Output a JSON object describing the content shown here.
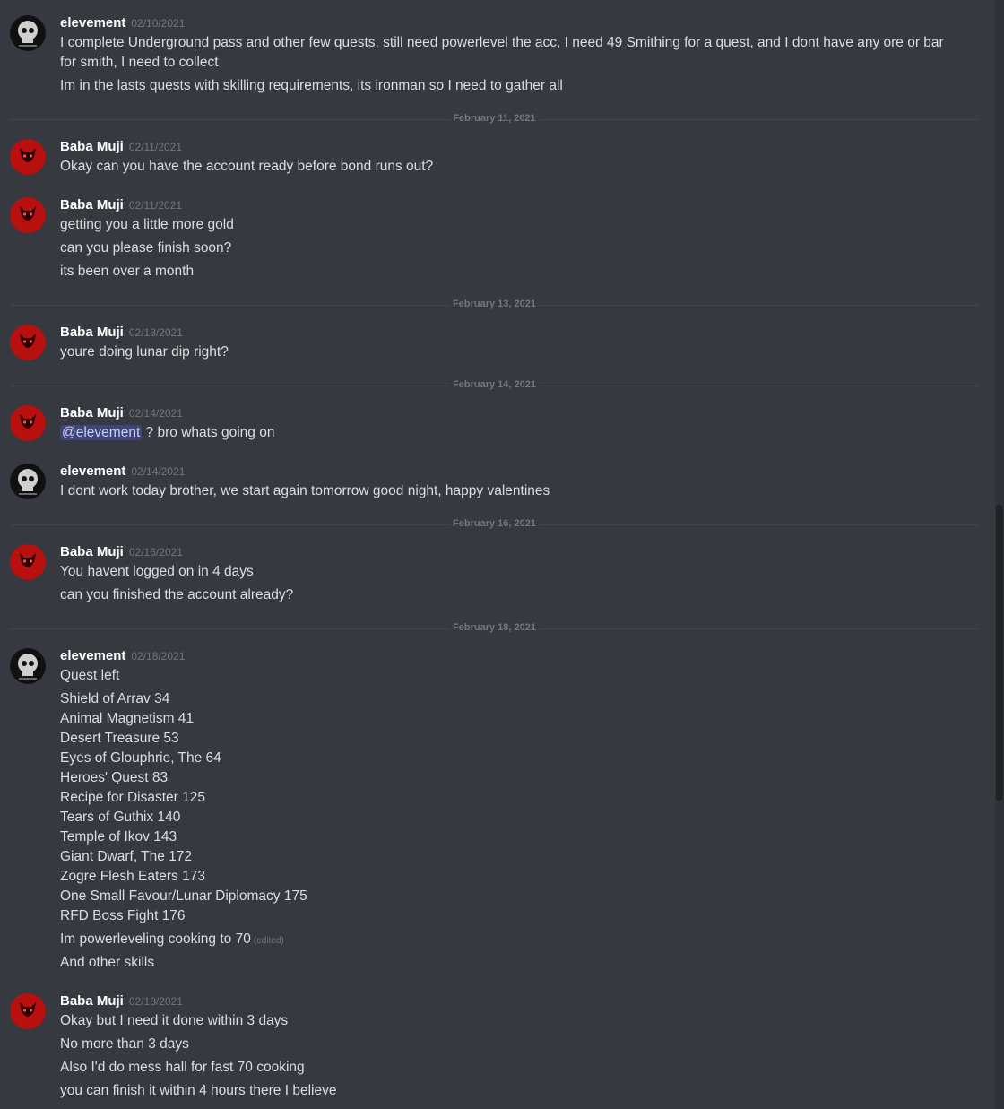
{
  "dividers": [
    {
      "text": "February 11, 2021"
    },
    {
      "text": "February 13, 2021"
    },
    {
      "text": "February 14, 2021"
    },
    {
      "text": "February 16, 2021"
    },
    {
      "text": "February 18, 2021"
    }
  ],
  "messages": [
    {
      "author": "elevement",
      "time": "02/10/2021",
      "lines": [
        "I complete Underground pass and other few quests, still need powerlevel the acc, I need 49 Smithing for a quest, and I dont have any ore or bar for smith, I need to collect",
        "Im in the lasts quests with skilling requirements, its ironman so I need to gather all"
      ]
    },
    {
      "author": "Baba Muji",
      "time": "02/11/2021",
      "lines": [
        "Okay can you have the account ready before bond runs out?"
      ]
    },
    {
      "author": "Baba Muji",
      "time": "02/11/2021",
      "lines": [
        "getting you a little more gold",
        "can you please finish soon?",
        "its been over a month"
      ]
    },
    {
      "author": "Baba Muji",
      "time": "02/13/2021",
      "lines": [
        "youre doing lunar dip right?"
      ]
    },
    {
      "author": "Baba Muji",
      "time": "02/14/2021",
      "mention": "@elevement",
      "lines": [
        " ? bro whats going on"
      ]
    },
    {
      "author": "elevement",
      "time": "02/14/2021",
      "lines": [
        "I dont work today brother, we start again tomorrow good night, happy valentines"
      ]
    },
    {
      "author": "Baba Muji",
      "time": "02/16/2021",
      "lines": [
        "You havent logged on in 4 days",
        "can you finished the account already?"
      ]
    },
    {
      "author": "elevement",
      "time": "02/18/2021",
      "edited": "(edited)",
      "lines": [
        "Quest left",
        "Shield of Arrav 34",
        "Animal Magnetism 41",
        "Desert Treasure 53",
        "Eyes of Glouphrie, The 64",
        "Heroes' Quest 83",
        "Recipe for Disaster 125",
        "Tears of Guthix 140",
        "Temple of Ikov 143",
        "Giant Dwarf, The 172",
        "Zogre Flesh Eaters 173",
        "One Small Favour/Lunar Diplomacy 175",
        "RFD Boss Fight 176",
        "Im powerleveling cooking to 70",
        "And other skills"
      ]
    },
    {
      "author": "Baba Muji",
      "time": "02/18/2021",
      "lines": [
        "Okay but I need it done within 3 days",
        "No more than 3 days",
        "Also I'd do mess hall for fast 70 cooking",
        "you can finish it within 4 hours there I believe"
      ]
    }
  ],
  "colors": {
    "background": "#36393f",
    "username": "#ffffff",
    "timestamp": "#72767d",
    "text": "#dcddde",
    "mention": "#c9cdfb"
  }
}
